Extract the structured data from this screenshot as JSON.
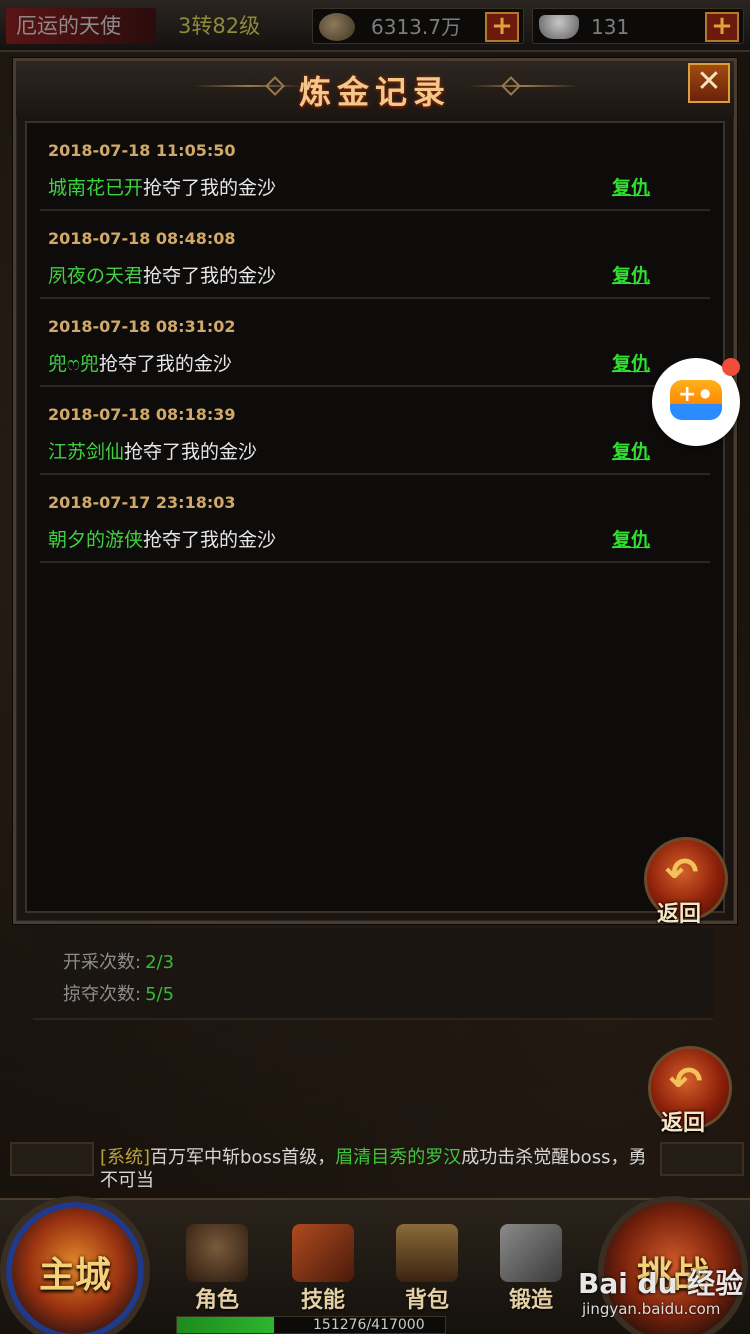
{
  "topbar": {
    "player_name": "厄运的天使",
    "level": "3转82级",
    "gold": "6313.7万",
    "ingots": "131",
    "plus_label": "+"
  },
  "dialog": {
    "title": "炼金记录",
    "close_label": "✕",
    "records": [
      {
        "time": "2018-07-18 11:05:50",
        "player": "城南花已开",
        "action": "抢夺了我的金沙",
        "revenge": "复仇"
      },
      {
        "time": "2018-07-18 08:48:08",
        "player": "夙夜の天君",
        "action": "抢夺了我的金沙",
        "revenge": "复仇"
      },
      {
        "time": "2018-07-18 08:31:02",
        "player": "兜ෆ兜",
        "action": "抢夺了我的金沙",
        "revenge": "复仇"
      },
      {
        "time": "2018-07-18 08:18:39",
        "player": "江苏剑仙",
        "action": "抢夺了我的金沙",
        "revenge": "复仇"
      },
      {
        "time": "2018-07-17 23:18:03",
        "player": "朝夕的游侠",
        "action": "抢夺了我的金沙",
        "revenge": "复仇"
      }
    ],
    "back_label": "返回",
    "back_arrow": "↶"
  },
  "counters": {
    "mining_label": "开采次数:",
    "mining_value": "2/3",
    "plunder_label": "掠夺次数:",
    "plunder_value": "5/5"
  },
  "chat": {
    "tag": "[系统]",
    "text_a": "百万军中斩boss首级，",
    "highlight": "眉清目秀的罗汉",
    "text_b": "成功击杀觉醒boss，勇不可当"
  },
  "bottom_nav": {
    "main_city": "主城",
    "right_orb": "挑战",
    "role": "角色",
    "skill": "技能",
    "bag": "背包",
    "forge": "锻造",
    "exp_text": "151276/417000",
    "exp_fraction": 0.3628,
    "back_label": "返回",
    "back_arrow": "↶"
  },
  "watermark": {
    "main": "Bai du 经验",
    "sub": "jingyan.baidu.com"
  },
  "colors": {
    "player_green": "#3fd13f",
    "time_gold": "#d2a868",
    "revenge_green": "#2ee12e",
    "title_gold": "#f2c98a"
  },
  "icons": [
    "coin-icon",
    "ingot-icon",
    "close-icon",
    "back-arrow-icon",
    "game-controller-icon"
  ]
}
